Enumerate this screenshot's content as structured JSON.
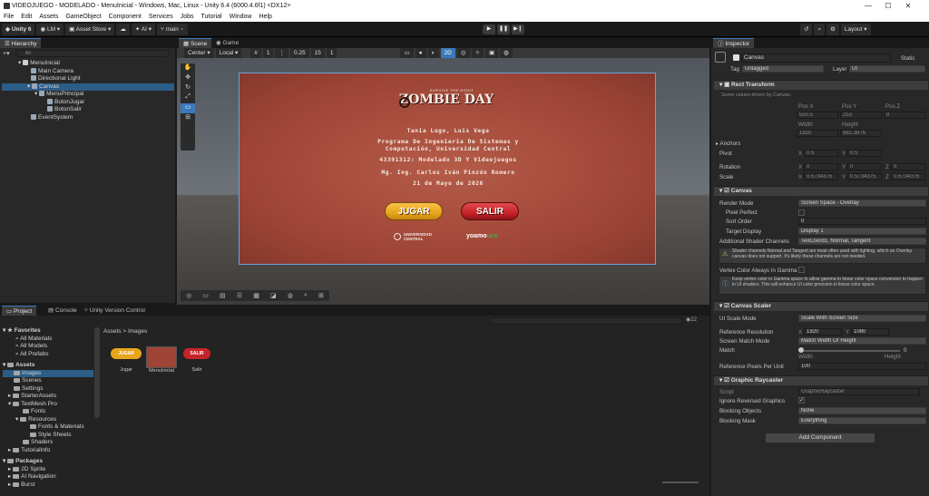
{
  "titlebar": {
    "title": "VIDEOJUEGO - MODELADO - MenuInicial - Windows, Mac, Linux - Unity 6.4 (6000.4.6f1) <DX12>",
    "minimize": "—",
    "maximize": "☐",
    "close": "✕"
  },
  "menu": [
    "File",
    "Edit",
    "Assets",
    "GameObject",
    "Component",
    "Services",
    "Jobs",
    "Tutorial",
    "Window",
    "Help"
  ],
  "toolbar": {
    "unity": "Unity 6",
    "account": "LM",
    "store": "Asset Store",
    "ai": "AI",
    "branch": "main",
    "layout": "Layout"
  },
  "hierarchy": {
    "tab": "Hierarchy",
    "search": "All",
    "scene": "MenuInicial",
    "items": [
      "Main Camera",
      "Directional Light",
      "Canvas",
      "MenuPrincipal",
      "BotonJugar",
      "BotonSalir",
      "EventSystem"
    ]
  },
  "scene": {
    "tab_scene": "Scene",
    "tab_game": "Game",
    "pivot": "Center",
    "space": "Local",
    "grid_val": "1",
    "snap_val": "0.25",
    "angle_val": "15",
    "scale_val": "1",
    "mode_2d": "2D"
  },
  "game": {
    "badge": "SURVIVE THE NIGHT",
    "logo": "ZOMBIE DAY",
    "authors": "Tania Lugo, Luis Vega",
    "program_1": "Programa De Ingeniería De Sistemas y",
    "program_2": "Computación, Universidad Central",
    "course": "43391312: Modelado 3D Y Videojuegos",
    "teacher": "Mg. Ing. Carlos Iván Pinzón Romero",
    "date": "21 de Mayo de 2026",
    "btn_play": "JUGAR",
    "btn_exit": "SALIR",
    "univ_1": "UNIVERSIDAD",
    "univ_2": "CENTRAL",
    "brand": "yoamo",
    "brand2": "uce"
  },
  "project": {
    "tab_project": "Project",
    "tab_console": "Console",
    "tab_vc": "Unity Version Control",
    "favorites": "Favorites",
    "fav_items": [
      "All Materials",
      "All Models",
      "All Prefabs"
    ],
    "assets": "Assets",
    "asset_items": [
      "Images",
      "Scenes",
      "Settings",
      "StarterAssets",
      "TextMesh Pro",
      "Fonts",
      "Resources",
      "Fonts & Materials",
      "Style Sheets",
      "Shaders",
      "TutorialInfo"
    ],
    "packages": "Packages",
    "package_items": [
      "2D Sprite",
      "AI Navigation",
      "Burst"
    ],
    "breadcrumb_1": "Assets",
    "breadcrumb_sep": ">",
    "breadcrumb_2": "Images",
    "files": [
      "Jugar",
      "MenuInicial",
      "Salir"
    ],
    "count": "22"
  },
  "inspector": {
    "tab": "Inspector",
    "object": "Canvas",
    "static": "Static",
    "tag_label": "Tag",
    "tag": "Untagged",
    "layer_label": "Layer",
    "layer": "UI",
    "rect": {
      "title": "Rect Transform",
      "note": "Some values driven by Canvas.",
      "posx_l": "Pos X",
      "posy_l": "Pos Y",
      "posz_l": "Pos Z",
      "posx": "550.5",
      "posy": "253",
      "posz": "0",
      "w_l": "Width",
      "h_l": "Height",
      "w": "1920",
      "h": "882.3876",
      "anchors": "Anchors",
      "pivot": "Pivot",
      "px": "0.5",
      "py": "0.5",
      "rotation": "Rotation",
      "rx": "0",
      "ry": "0",
      "rz": "0",
      "scale": "Scale",
      "sx": "0.5734375",
      "sy": "0.5734375",
      "sz": "0.5734375",
      "xl": "X",
      "yl": "Y",
      "zl": "Z"
    },
    "canvas": {
      "title": "Canvas",
      "render_mode_l": "Render Mode",
      "render_mode": "Screen Space - Overlay",
      "pixel_perfect_l": "Pixel Perfect",
      "sort_order_l": "Sort Order",
      "sort_order": "0",
      "target_display_l": "Target Display",
      "target_display": "Display 1",
      "shader_channels_l": "Additional Shader Channels",
      "shader_channels": "TexCoord1, Normal, Tangent",
      "warn1": "Shader channels Normal and Tangent are most often used with lighting, which an Overlay canvas does not support. It's likely these channels are not needed.",
      "vertex_l": "Vertex Color Always In Gamma",
      "warn2": "Keep vertex color in Gamma space to allow gamma to linear color space conversion to happen in UI shaders. This will enhance UI color precision in linear color space."
    },
    "scaler": {
      "title": "Canvas Scaler",
      "ui_scale_l": "UI Scale Mode",
      "ui_scale": "Scale With Screen Size",
      "ref_res_l": "Reference Resolution",
      "rx": "1920",
      "ry": "1080",
      "match_mode_l": "Screen Match Mode",
      "match_mode": "Match Width Or Height",
      "match_l": "Match",
      "match_val": "0",
      "match_width": "Width",
      "match_height": "Height",
      "rppu_l": "Reference Pixels Per Unit",
      "rppu": "100"
    },
    "raycaster": {
      "title": "Graphic Raycaster",
      "script_l": "Script",
      "script": "GraphicRaycaster",
      "ignore_l": "Ignore Reversed Graphics",
      "blocking_l": "Blocking Objects",
      "blocking": "None",
      "mask_l": "Blocking Mask",
      "mask": "Everything"
    },
    "add_component": "Add Component"
  },
  "colors": {
    "accent": "#3a79bb",
    "selected": "#2c5d87",
    "play_btn": "#e8a51c",
    "exit_btn": "#c7242a",
    "bg_game": "#a8483a"
  }
}
